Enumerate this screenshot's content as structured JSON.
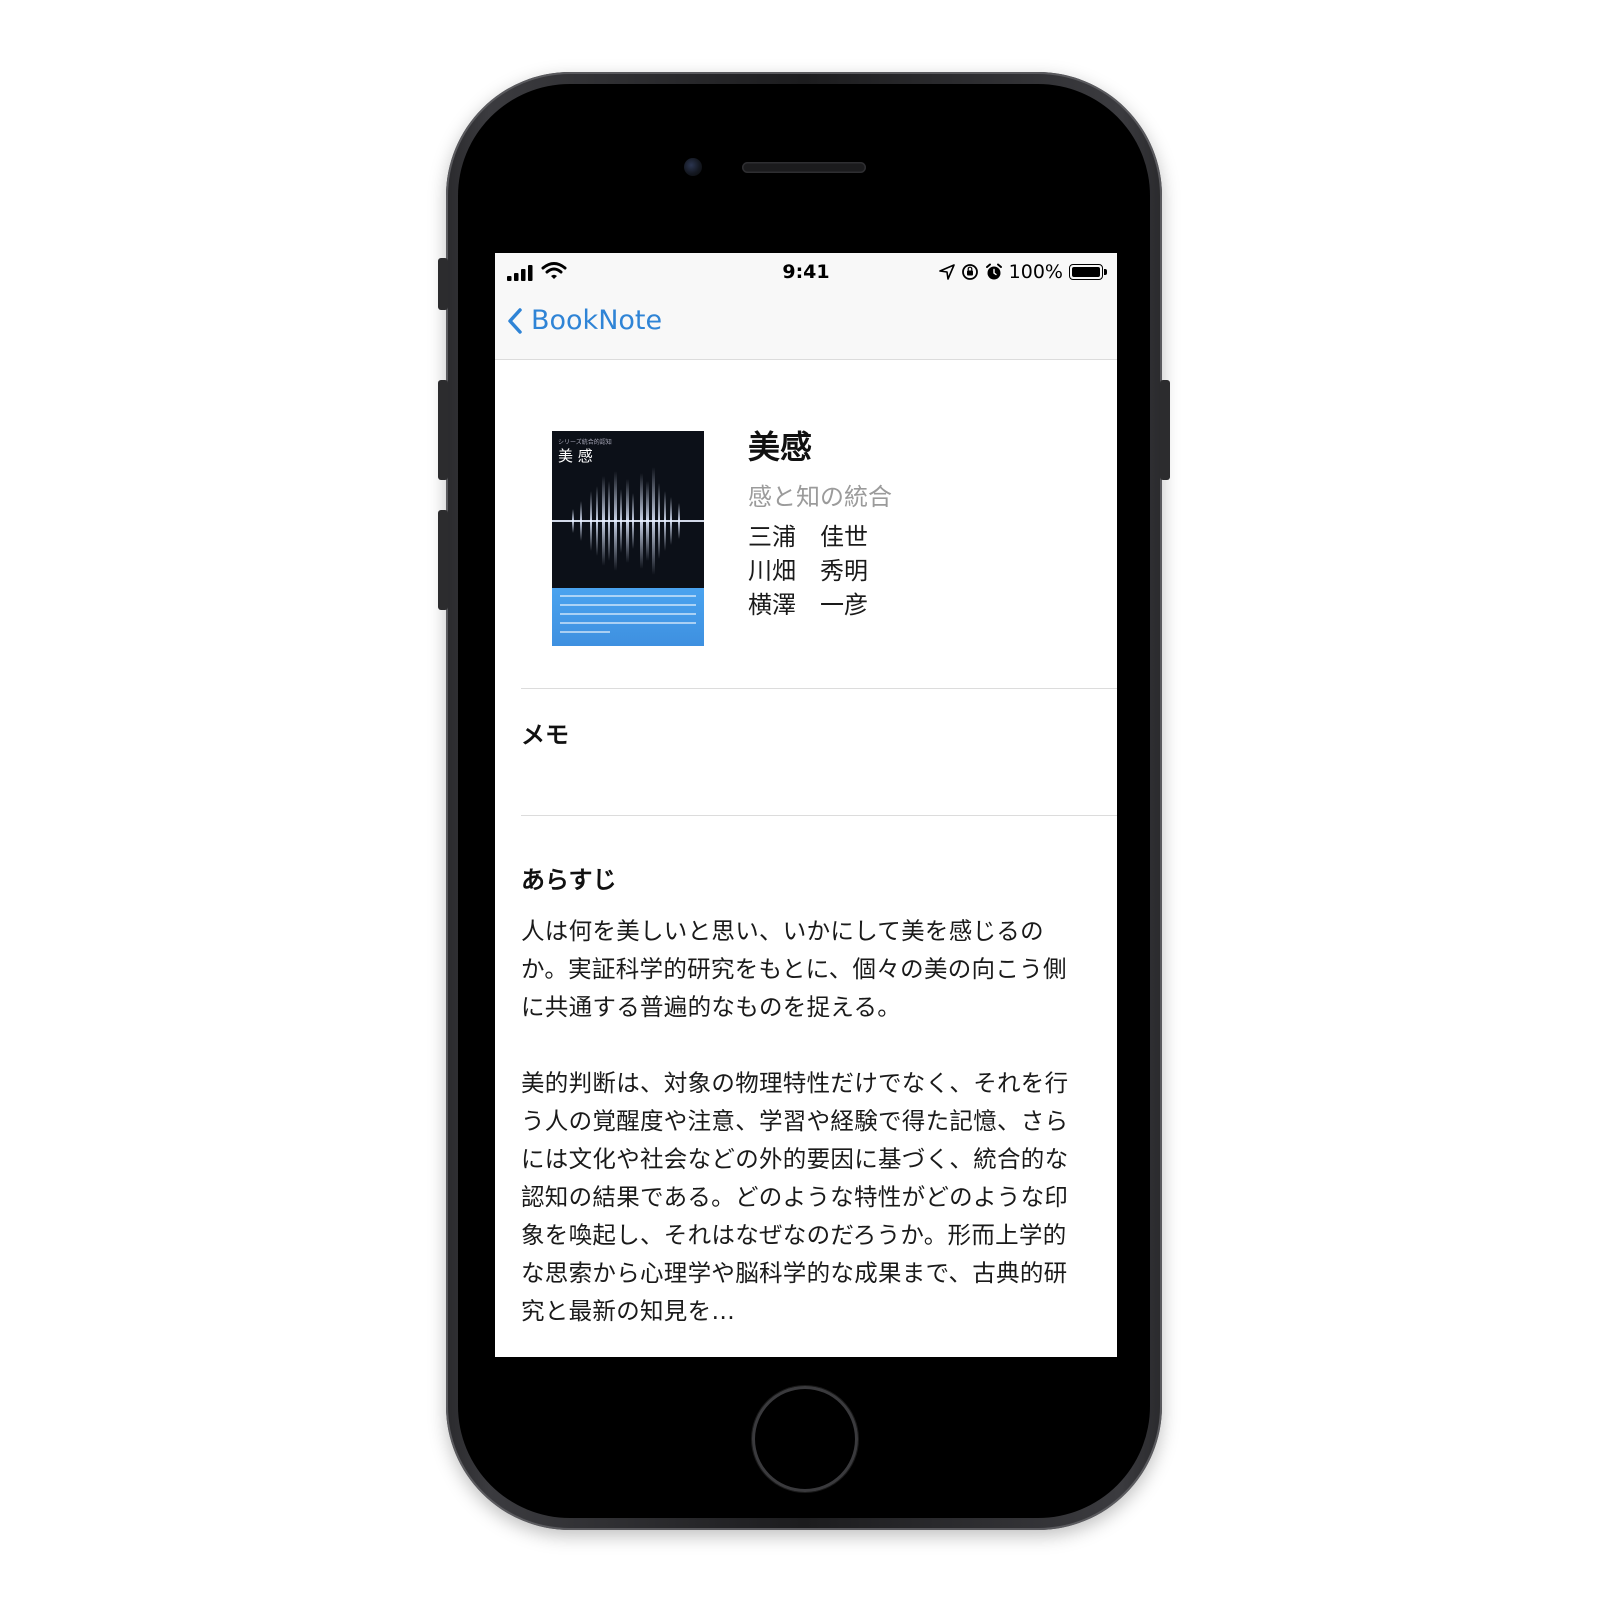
{
  "status_bar": {
    "time": "9:41",
    "battery": "100%"
  },
  "nav": {
    "back_label": "BookNote"
  },
  "book": {
    "title": "美感",
    "subtitle": "感と知の統合",
    "authors": [
      "三浦　佳世",
      "川畑　秀明",
      "横澤　一彦"
    ],
    "cover": {
      "series_text": "シリーズ統合的認知",
      "title_text": "美 感"
    }
  },
  "memo": {
    "heading": "メモ"
  },
  "synopsis": {
    "heading": "あらすじ",
    "paragraph1": "人は何を美しいと思い、いかにして美を感じるのか。実証科学的研究をもとに、個々の美の向こう側に共通する普遍的なものを捉える。",
    "paragraph2": "美的判断は、対象の物理特性だけでなく、それを行う人の覚醒度や注意、学習や経験で得た記憶、さらには文化や社会などの外的要因に基づく、統合的な認知の結果である。どのような特性がどのような印象を喚起し、それはなぜなのだろうか。形而上学的な思索から心理学や脳科学的な成果まで、古典的研究と最新の知見を…"
  },
  "colors": {
    "accent": "#2f84d6",
    "subtitle_gray": "#9b9b9b",
    "cover_blue": "#4aa3ef"
  }
}
